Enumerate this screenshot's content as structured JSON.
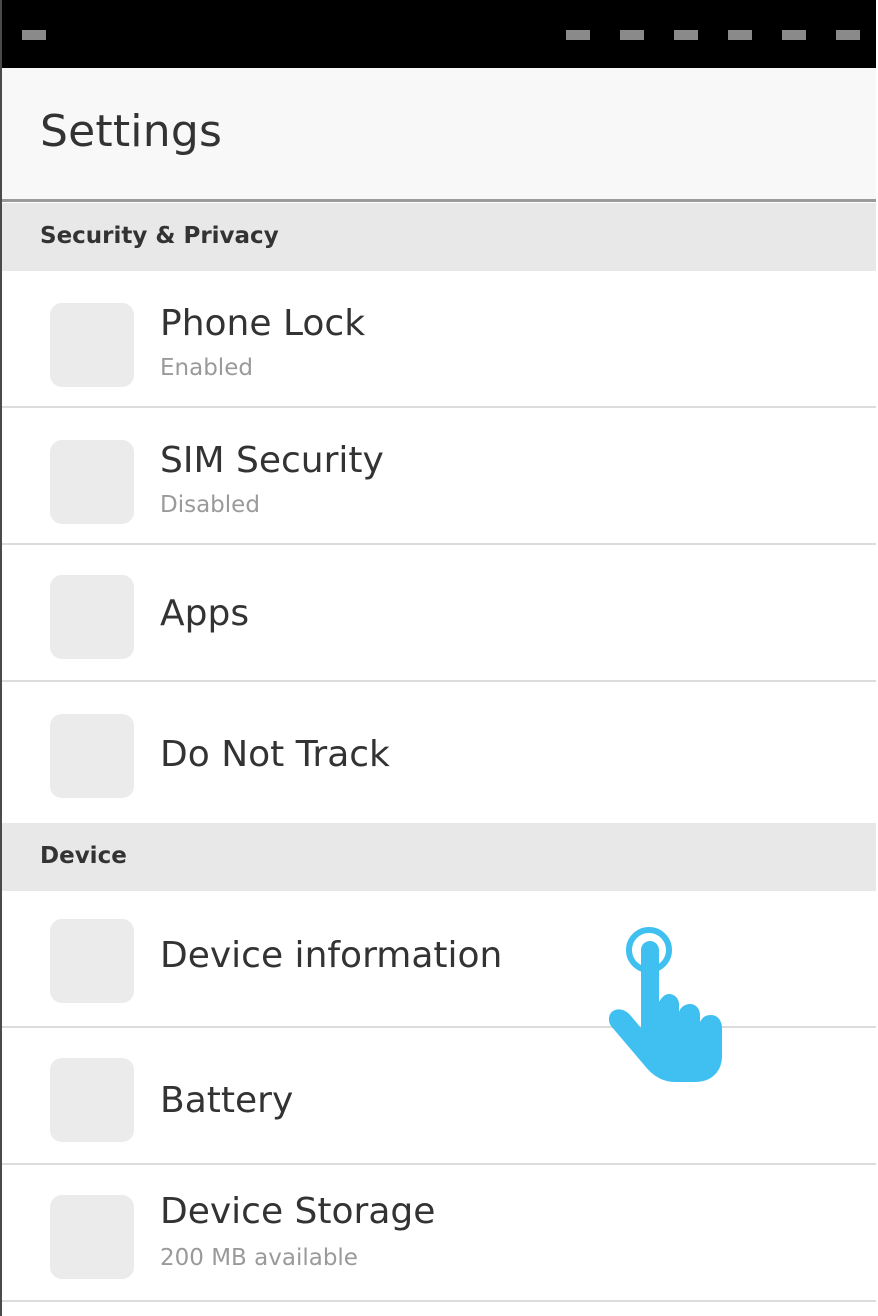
{
  "header": {
    "title": "Settings"
  },
  "sections": [
    {
      "label": "Security & Privacy",
      "items": [
        {
          "title": "Phone Lock",
          "subtitle": "Enabled"
        },
        {
          "title": "SIM Security",
          "subtitle": "Disabled"
        },
        {
          "title": "Apps",
          "subtitle": ""
        },
        {
          "title": "Do Not Track",
          "subtitle": ""
        }
      ]
    },
    {
      "label": "Device",
      "items": [
        {
          "title": "Device information",
          "subtitle": ""
        },
        {
          "title": "Battery",
          "subtitle": ""
        },
        {
          "title": "Device Storage",
          "subtitle": "200 MB available"
        }
      ]
    }
  ],
  "colors": {
    "status_bar": "#000000",
    "section_header_bg": "#e8e8e8",
    "icon_placeholder": "#ebebeb",
    "touch_indicator": "#3fc0f0"
  },
  "icons": {
    "touch_indicator": "tap-hand-icon"
  }
}
